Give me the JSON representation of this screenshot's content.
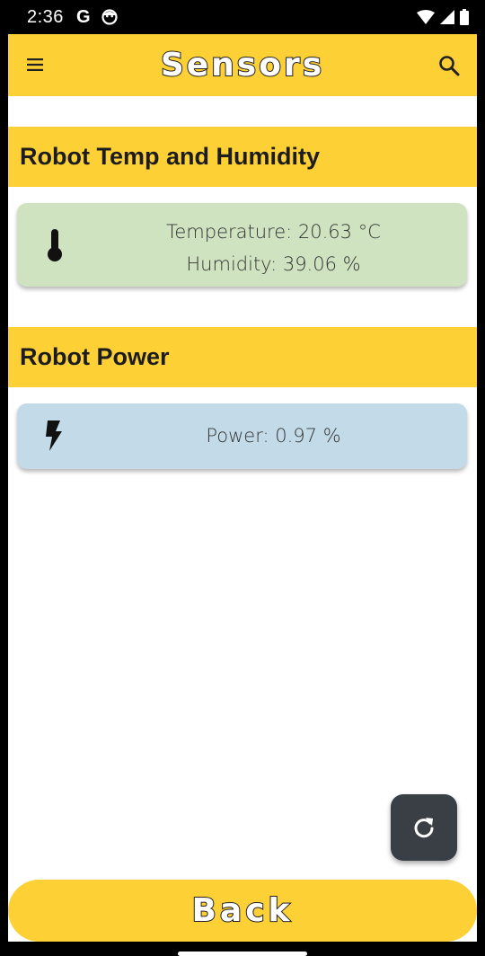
{
  "status_bar": {
    "time": "2:36",
    "g_label": "G"
  },
  "app_bar": {
    "title": "Sensors"
  },
  "sections": {
    "temp_humidity": {
      "title": "Robot Temp and Humidity",
      "temperature_text": "Temperature: 20.63 °C",
      "humidity_text": "Humidity: 39.06 %",
      "card_color": "#cfe3c1"
    },
    "power": {
      "title": "Robot Power",
      "power_text": "Power: 0.97 %",
      "card_color": "#c3dbe8"
    }
  },
  "buttons": {
    "back_label": "Back"
  },
  "icons": {
    "menu": "menu-icon",
    "search": "search-icon",
    "thermometer": "thermometer-icon",
    "power": "lightning-bolt-icon",
    "refresh": "refresh-icon"
  },
  "colors": {
    "accent": "#fdd036",
    "fab": "#3a3f45"
  }
}
